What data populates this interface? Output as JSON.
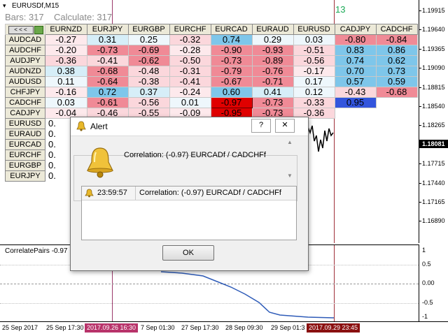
{
  "chart": {
    "symbol_title": "EURUSDf,M15",
    "bars_text": "Bars: 317",
    "calculate_text": "Calculate: 317",
    "top_counter": "13"
  },
  "price_axis": {
    "labels": [
      "1.19915",
      "1.19640",
      "1.19365",
      "1.19090",
      "1.18815",
      "1.18540",
      "1.18265",
      "1.17990",
      "1.17715",
      "1.17440",
      "1.17165",
      "1.16890"
    ],
    "current_price": "1.18081"
  },
  "indicator": {
    "label": "CorrelatePairs -0.97",
    "scale": [
      "1",
      "0.5",
      "0.00",
      "-0.5",
      "-1"
    ]
  },
  "time_axis": {
    "labels": [
      "25 Sep 2017",
      "25 Sep 17:30",
      "2017.09.26 16:30",
      "7 Sep 01:30",
      "27 Sep 17:30",
      "28 Sep 09:30",
      "29 Sep 01:3",
      "2017.09.29 23:45"
    ],
    "highlight_left_color": "#b8336a",
    "highlight_right_color": "#8a1010"
  },
  "matrix": {
    "nav_label": "< < <",
    "columns": [
      "EURNZD",
      "EURJPY",
      "EURGBP",
      "EURCHF",
      "EURCAD",
      "EURAUD",
      "EURUSD",
      "CADJPY",
      "CADCHF"
    ],
    "rows": [
      {
        "name": "AUDCAD",
        "values": [
          "-0.27",
          "0.31",
          "0.25",
          "-0.32",
          "0.74",
          "0.29",
          "0.03",
          "-0.80",
          "-0.84"
        ]
      },
      {
        "name": "AUDCHF",
        "values": [
          "-0.20",
          "-0.73",
          "-0.69",
          "-0.28",
          "-0.90",
          "-0.93",
          "-0.51",
          "0.83",
          "0.86"
        ]
      },
      {
        "name": "AUDJPY",
        "values": [
          "-0.36",
          "-0.41",
          "-0.62",
          "-0.50",
          "-0.73",
          "-0.89",
          "-0.56",
          "0.74",
          "0.62"
        ]
      },
      {
        "name": "AUDNZD",
        "values": [
          "0.38",
          "-0.68",
          "-0.48",
          "-0.31",
          "-0.79",
          "-0.76",
          "-0.17",
          "0.70",
          "0.73"
        ]
      },
      {
        "name": "AUDUSD",
        "values": [
          "0.11",
          "-0.64",
          "-0.38",
          "-0.41",
          "-0.67",
          "-0.71",
          "0.17",
          "0.57",
          "0.59"
        ]
      },
      {
        "name": "CHFJPY",
        "values": [
          "-0.16",
          "0.72",
          "0.37",
          "-0.24",
          "0.60",
          "0.41",
          "0.12",
          "-0.43",
          "-0.68"
        ]
      },
      {
        "name": "CADCHF",
        "values": [
          "0.03",
          "-0.61",
          "-0.56",
          "0.01",
          "-0.97",
          "-0.73",
          "-0.33",
          "0.95",
          ""
        ]
      },
      {
        "name": "CADJPY",
        "values": [
          "-0.04",
          "-0.46",
          "-0.55",
          "-0.09",
          "-0.95",
          "-0.73",
          "-0.36",
          "",
          ""
        ]
      },
      {
        "name": "EURUSD",
        "values": [
          "0.",
          "",
          "",
          "",
          "",
          "",
          "",
          "",
          ""
        ]
      },
      {
        "name": "EURAUD",
        "values": [
          "0.",
          "",
          "",
          "",
          "",
          "",
          "",
          "",
          ""
        ]
      },
      {
        "name": "EURCAD",
        "values": [
          "0.",
          "",
          "",
          "",
          "",
          "",
          "",
          "",
          ""
        ]
      },
      {
        "name": "EURCHF",
        "values": [
          "0.",
          "",
          "",
          "",
          "",
          "",
          "",
          "",
          ""
        ]
      },
      {
        "name": "EURGBP",
        "values": [
          "0.",
          "",
          "",
          "",
          "",
          "",
          "",
          "",
          ""
        ]
      },
      {
        "name": "EURJPY",
        "values": [
          "0.",
          "",
          "",
          "",
          "",
          "",
          "",
          "",
          ""
        ]
      }
    ],
    "colors": {
      "strong_pos": "#7ec6ea",
      "weak_pos": "#d6eef8",
      "strong_neg": "#f08a96",
      "weak_neg": "#fbd7dc",
      "selected_red": "#e00000",
      "selected_blue": "#3355dd"
    }
  },
  "alert": {
    "title": "Alert",
    "help_button": "?",
    "close_button": "✕",
    "message": "Correlation: (-0.97) EURCADf / CADCHFf",
    "log": [
      {
        "time": "23:59:57",
        "message": "Correlation: (-0.97) EURCADf / CADCHFf"
      }
    ],
    "ok_label": "OK",
    "icon": "bell-icon"
  }
}
